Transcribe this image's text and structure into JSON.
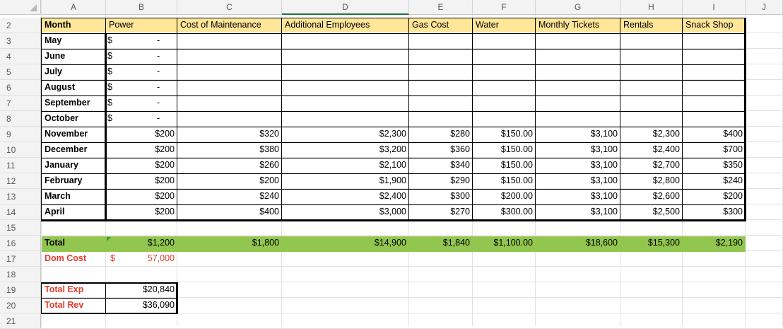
{
  "columns": [
    "A",
    "B",
    "C",
    "D",
    "E",
    "F",
    "G",
    "H",
    "I",
    "J"
  ],
  "rows": [
    "2",
    "3",
    "4",
    "5",
    "6",
    "7",
    "8",
    "9",
    "10",
    "11",
    "12",
    "13",
    "14",
    "15",
    "16",
    "17",
    "18",
    "19",
    "20",
    "21"
  ],
  "headers": {
    "month": "Month",
    "power": "Power",
    "maintenance": "Cost of Maintenance",
    "employees": "Additional Employees",
    "gas": "Gas Cost",
    "water": "Water",
    "tickets": "Monthly Tickets",
    "rentals": "Rentals",
    "snack": "Snack Shop"
  },
  "months": [
    "May",
    "June",
    "July",
    "August",
    "September",
    "October",
    "November",
    "December",
    "January",
    "February",
    "March",
    "April"
  ],
  "empty_power": {
    "symbol": "$",
    "dash": "-"
  },
  "data_rows": [
    {
      "power": "$200",
      "maint": "$320",
      "emp": "$2,300",
      "gas": "$280",
      "water": "$150.00",
      "tickets": "$3,100",
      "rentals": "$2,300",
      "snack": "$400"
    },
    {
      "power": "$200",
      "maint": "$380",
      "emp": "$3,200",
      "gas": "$360",
      "water": "$150.00",
      "tickets": "$3,100",
      "rentals": "$2,400",
      "snack": "$700"
    },
    {
      "power": "$200",
      "maint": "$260",
      "emp": "$2,100",
      "gas": "$340",
      "water": "$150.00",
      "tickets": "$3,100",
      "rentals": "$2,700",
      "snack": "$350"
    },
    {
      "power": "$200",
      "maint": "$200",
      "emp": "$1,900",
      "gas": "$290",
      "water": "$150.00",
      "tickets": "$3,100",
      "rentals": "$2,800",
      "snack": "$240"
    },
    {
      "power": "$200",
      "maint": "$240",
      "emp": "$2,400",
      "gas": "$300",
      "water": "$200.00",
      "tickets": "$3,100",
      "rentals": "$2,600",
      "snack": "$200"
    },
    {
      "power": "$200",
      "maint": "$400",
      "emp": "$3,000",
      "gas": "$270",
      "water": "$300.00",
      "tickets": "$3,100",
      "rentals": "$2,500",
      "snack": "$300"
    }
  ],
  "totals": {
    "label": "Total",
    "power": "$1,200",
    "maint": "$1,800",
    "emp": "$14,900",
    "gas": "$1,840",
    "water": "$1,100.00",
    "tickets": "$18,600",
    "rentals": "$15,300",
    "snack": "$2,190"
  },
  "dom_cost": {
    "label": "Dom Cost",
    "symbol": "$",
    "value": "57,000"
  },
  "total_exp": {
    "label": "Total Exp",
    "value": "$20,840"
  },
  "total_rev": {
    "label": "Total Rev",
    "value": "$36,090"
  },
  "colors": {
    "header_fill": "#ffe699",
    "total_fill": "#92c64f",
    "red_text": "#e53b2a",
    "selection": "#217346"
  }
}
